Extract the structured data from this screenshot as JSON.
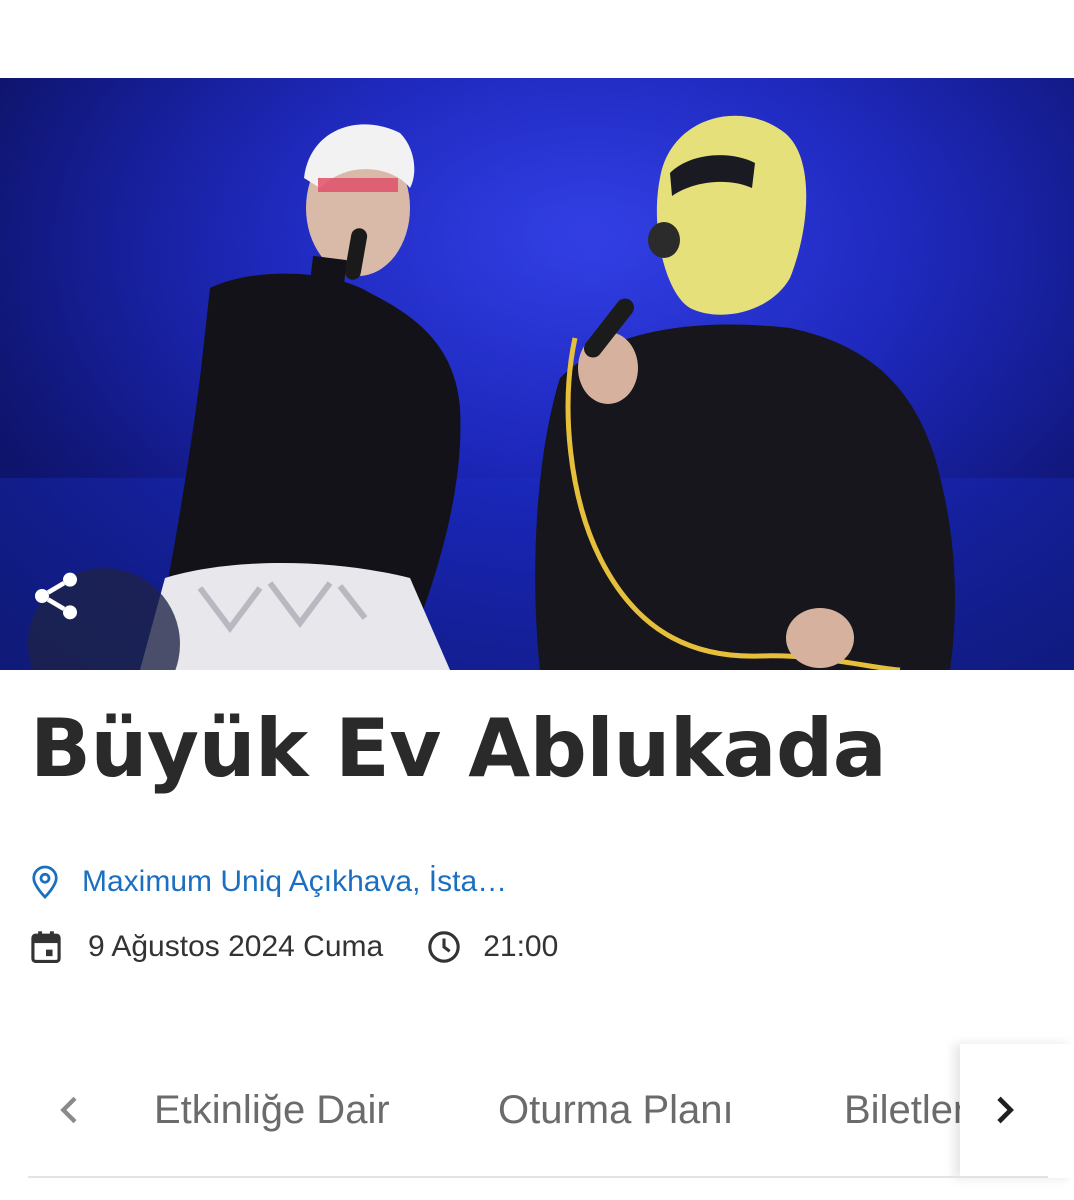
{
  "event": {
    "title": "Büyük Ev Ablukada",
    "venue": "Maximum Uniq Açıkhava, İsta…",
    "date": "9 Ağustos 2024 Cuma",
    "time": "21:00"
  },
  "tabs": [
    {
      "label": "Etkinliğe Dair"
    },
    {
      "label": "Oturma Planı"
    },
    {
      "label": "Biletler"
    }
  ],
  "icons": {
    "share": "share-icon",
    "location": "location-pin-icon",
    "calendar": "calendar-icon",
    "clock": "clock-icon",
    "prev": "chevron-left-icon",
    "next": "chevron-right-icon"
  },
  "colors": {
    "link": "#1b6fc0",
    "title": "#2a2a2a",
    "stage": "#1b25b8"
  }
}
